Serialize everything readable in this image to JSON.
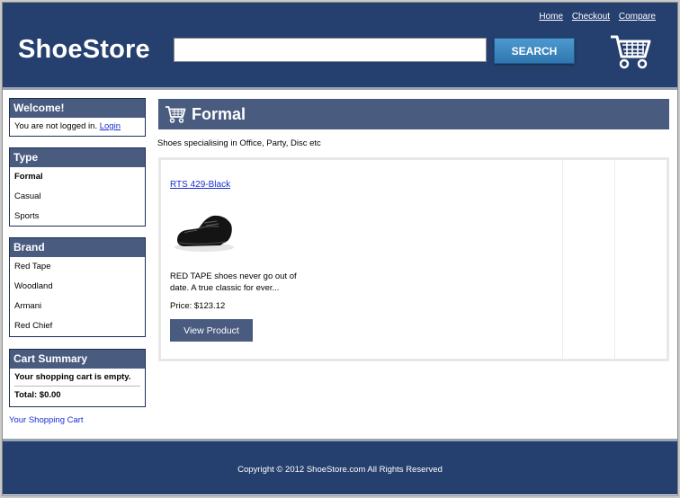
{
  "header": {
    "links": [
      "Home",
      "Checkout",
      "Compare"
    ],
    "logo": "ShoeStore",
    "search": {
      "value": "",
      "placeholder": ""
    },
    "search_button": "SEARCH",
    "cart_icon": "shopping-cart-icon"
  },
  "sidebar": {
    "welcome": {
      "title": "Welcome!",
      "text": "You are not logged in. ",
      "login": "Login"
    },
    "type": {
      "title": "Type",
      "items": [
        "Formal",
        "Casual",
        "Sports"
      ],
      "active": "Formal"
    },
    "brand": {
      "title": "Brand",
      "items": [
        "Red Tape",
        "Woodland",
        "Armani",
        "Red Chief"
      ]
    },
    "cart": {
      "title": "Cart Summary",
      "empty": "Your shopping cart is empty.",
      "total": "Total: $0.00"
    },
    "your_cart": "Your Shopping Cart"
  },
  "main": {
    "title": "Formal",
    "description": "Shoes specialising in Office, Party, Disc etc",
    "products": [
      {
        "name": "RTS 429-Black",
        "description": "RED TAPE shoes never go out of date. A true classic for ever...",
        "price": "Price: $123.12",
        "button": "View Product"
      }
    ]
  },
  "footer": {
    "copyright": "Copyright © 2012 ShoeStore.com All Rights Reserved"
  },
  "colors": {
    "brand": "#253f6e",
    "panel": "#4a5b80",
    "link": "#1a2fd0"
  }
}
